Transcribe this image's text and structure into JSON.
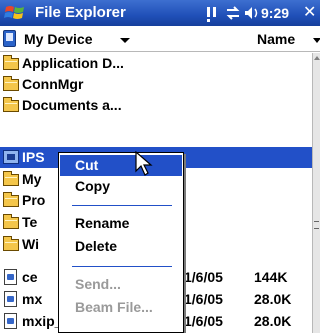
{
  "titlebar": {
    "title": "File Explorer",
    "time": "9:29",
    "close_label": "✕",
    "start_icon": "windows-flag-icon",
    "status_icons": [
      "notification-icon",
      "connectivity-icon",
      "volume-icon"
    ]
  },
  "location": {
    "device_label": "My Device",
    "sort_label": "Name"
  },
  "files": [
    {
      "name": "Application D...",
      "type": "folder"
    },
    {
      "name": "ConnMgr",
      "type": "folder"
    },
    {
      "name": "Documents a...",
      "type": "folder"
    },
    {
      "name": "IPS",
      "type": "system-folder",
      "selected": true
    },
    {
      "name": "My",
      "type": "folder"
    },
    {
      "name": "Pro",
      "type": "folder"
    },
    {
      "name": "Te",
      "type": "folder"
    },
    {
      "name": "Wi",
      "type": "folder"
    },
    {
      "name": "ce",
      "type": "file",
      "date": "1/6/05",
      "size": "144K"
    },
    {
      "name": "mx",
      "type": "file",
      "date": "1/6/05",
      "size": "28.0K"
    },
    {
      "name": "mxip_notify",
      "type": "file",
      "date": "1/6/05",
      "size": "28.0K"
    }
  ],
  "context_menu": {
    "items": [
      {
        "label": "Cut",
        "highlighted": true,
        "enabled": true
      },
      {
        "label": "Copy",
        "enabled": true
      },
      {
        "label": "Rename",
        "enabled": true
      },
      {
        "label": "Delete",
        "enabled": true
      },
      {
        "label": "Send...",
        "enabled": false
      },
      {
        "label": "Beam File...",
        "enabled": false
      }
    ]
  },
  "colors": {
    "titlebar": "#2050b8",
    "selection": "#2250c8",
    "disabled_text": "#9a9a9a"
  }
}
